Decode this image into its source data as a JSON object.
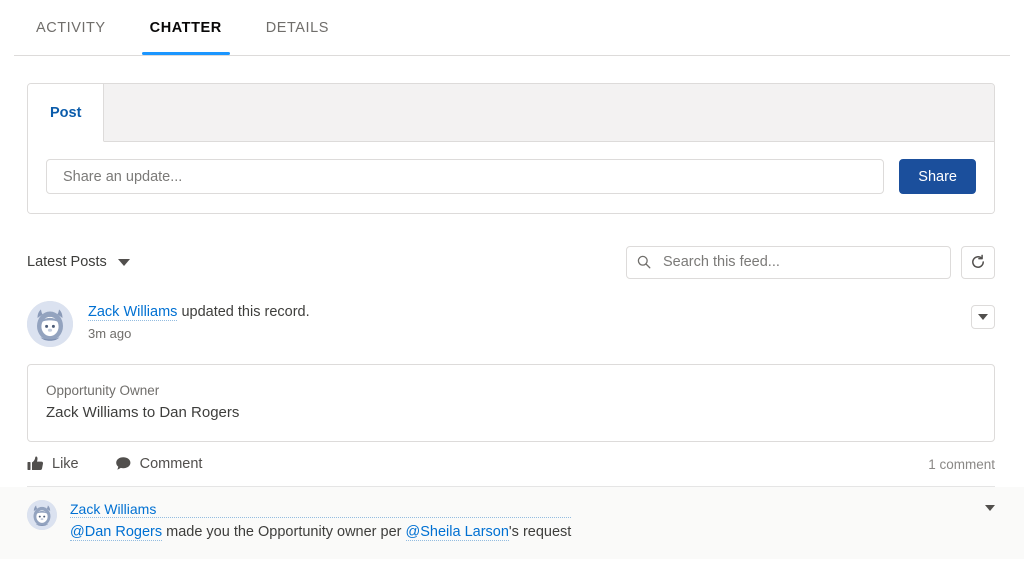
{
  "tabs": [
    {
      "label": "ACTIVITY",
      "active": false
    },
    {
      "label": "CHATTER",
      "active": true
    },
    {
      "label": "DETAILS",
      "active": false
    }
  ],
  "publisher": {
    "tab_label": "Post",
    "input_placeholder": "Share an update...",
    "input_value": "",
    "share_label": "Share"
  },
  "feed_controls": {
    "sort_label": "Latest Posts",
    "search_placeholder": "Search this feed...",
    "search_value": "",
    "refresh_icon": "refresh-icon"
  },
  "post": {
    "author": "Zack Williams",
    "action_text": " updated this record.",
    "timestamp": "3m ago",
    "menu_icon": "chevron-down-icon",
    "record_change": {
      "field_label": "Opportunity Owner",
      "field_value": "Zack Williams to Dan Rogers"
    },
    "like_label": "Like",
    "comment_label": "Comment",
    "comment_count": "1 comment"
  },
  "comment": {
    "author": "Zack Williams",
    "mention_1": "@Dan Rogers",
    "text_mid": " made you the Opportunity owner per ",
    "mention_2": "@Sheila Larson",
    "text_end": "'s request",
    "menu_icon": "chevron-down-icon"
  },
  "colors": {
    "brand_blue": "#0070d2",
    "active_tab_underline": "#1b96ff",
    "share_button": "#1b4f9c",
    "publisher_tab_text": "#0b5cab",
    "border": "#dddbda",
    "comment_bg": "#fafaf9"
  }
}
